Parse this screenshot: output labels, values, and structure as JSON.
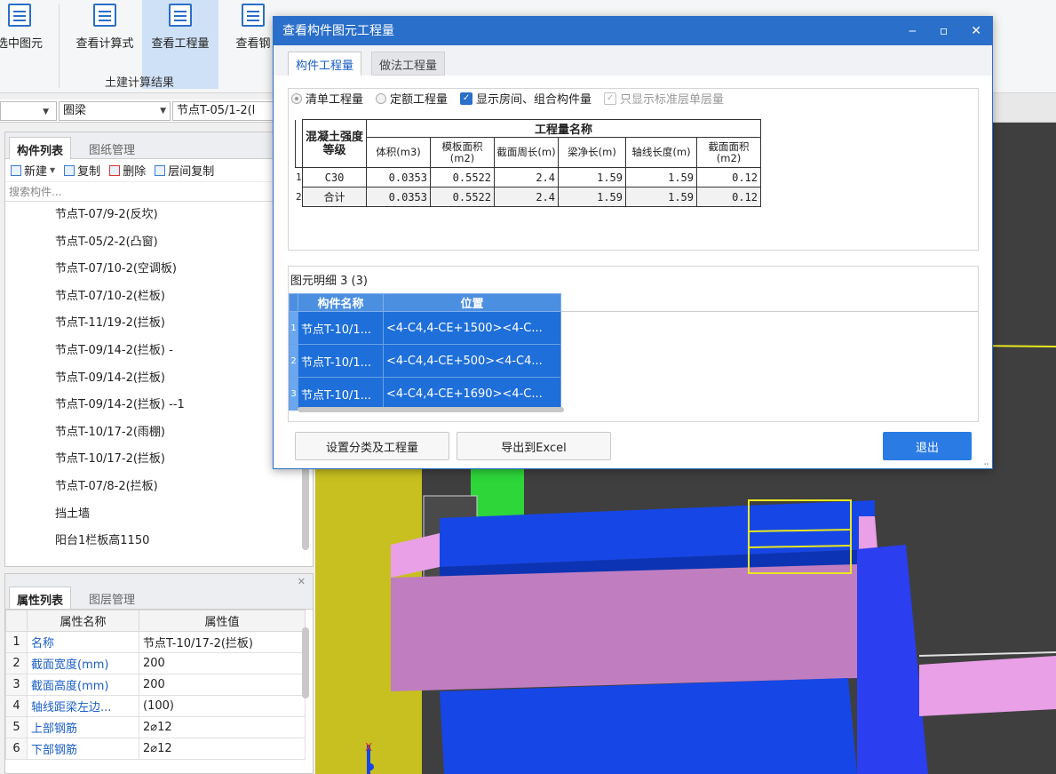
{
  "ribbon": {
    "buttons": [
      {
        "label": "选中图元"
      },
      {
        "label": "查看计算式"
      },
      {
        "label": "查看工程量"
      },
      {
        "label": "查看钢"
      }
    ],
    "group_label": "土建计算结果"
  },
  "toolbar2": {
    "combo1": "",
    "combo2": "圈梁",
    "combo3": "节点T-05/1-2(l"
  },
  "component_panel": {
    "tabs": [
      "构件列表",
      "图纸管理"
    ],
    "tools": [
      "新建",
      "复制",
      "删除",
      "层间复制"
    ],
    "search_placeholder": "搜索构件...",
    "items": [
      "节点T-07/9-2(反坎)",
      "节点T-05/2-2(凸窗)",
      "节点T-07/10-2(空调板)",
      "节点T-07/10-2(栏板)",
      "节点T-11/19-2(拦板)",
      "节点T-09/14-2(拦板) -",
      "节点T-09/14-2(拦板)",
      "节点T-09/14-2(拦板) --1",
      "节点T-10/17-2(雨棚)",
      "节点T-10/17-2(拦板)",
      "节点T-07/8-2(拦板)",
      "挡土墙",
      "阳台1栏板高1150"
    ]
  },
  "property_panel": {
    "tabs": [
      "属性列表",
      "图层管理"
    ],
    "headers": [
      "属性名称",
      "属性值"
    ],
    "rows": [
      {
        "idx": "1",
        "name": "名称",
        "value": "节点T-10/17-2(拦板)"
      },
      {
        "idx": "2",
        "name": "截面宽度(mm)",
        "value": "200"
      },
      {
        "idx": "3",
        "name": "截面高度(mm)",
        "value": "200"
      },
      {
        "idx": "4",
        "name": "轴线距梁左边...",
        "value": "(100)"
      },
      {
        "idx": "5",
        "name": "上部钢筋",
        "value": "2⌀12"
      },
      {
        "idx": "6",
        "name": "下部钢筋",
        "value": "2⌀12"
      }
    ]
  },
  "dialog": {
    "title": "查看构件图元工程量",
    "controls": [
      "‒",
      "▫",
      "✕"
    ],
    "tabs": [
      "构件工程量",
      "做法工程量"
    ],
    "options": {
      "radio1": "清单工程量",
      "radio2": "定额工程量",
      "check1": "显示房间、组合构件量",
      "check2": "只显示标准层单层量"
    },
    "qty_table": {
      "group_header": "工程量名称",
      "row_header": "混凝土强度等级",
      "columns": [
        "体积(m3)",
        "模板面积(m2)",
        "截面周长(m)",
        "梁净长(m)",
        "轴线长度(m)",
        "截面面积(m2)"
      ],
      "rows": [
        {
          "n": "1",
          "grade": "C30",
          "values": [
            "0.0353",
            "0.5522",
            "2.4",
            "1.59",
            "1.59",
            "0.12"
          ]
        },
        {
          "n": "2",
          "grade": "合计",
          "values": [
            "0.0353",
            "0.5522",
            "2.4",
            "1.59",
            "1.59",
            "0.12"
          ]
        }
      ]
    },
    "detail": {
      "title": "图元明细  3 (3)",
      "headers": [
        "构件名称",
        "位置"
      ],
      "rows": [
        {
          "n": "1",
          "name": "节点T-10/1...",
          "pos": "<4-C4,4-CE+1500><4-C..."
        },
        {
          "n": "2",
          "name": "节点T-10/1...",
          "pos": "<4-C4,4-CE+500><4-C4..."
        },
        {
          "n": "3",
          "name": "节点T-10/1...",
          "pos": "<4-C4,4-CE+1690><4-C..."
        }
      ]
    },
    "buttons": {
      "settings": "设置分类及工程量",
      "export": "导出到Excel",
      "exit": "退出"
    }
  },
  "colors": {
    "accent": "#2a6fc9",
    "selection": "#1e6fd9",
    "yellow": "#c8c020",
    "pink": "#e9a0e6",
    "blue": "#1746e6"
  }
}
